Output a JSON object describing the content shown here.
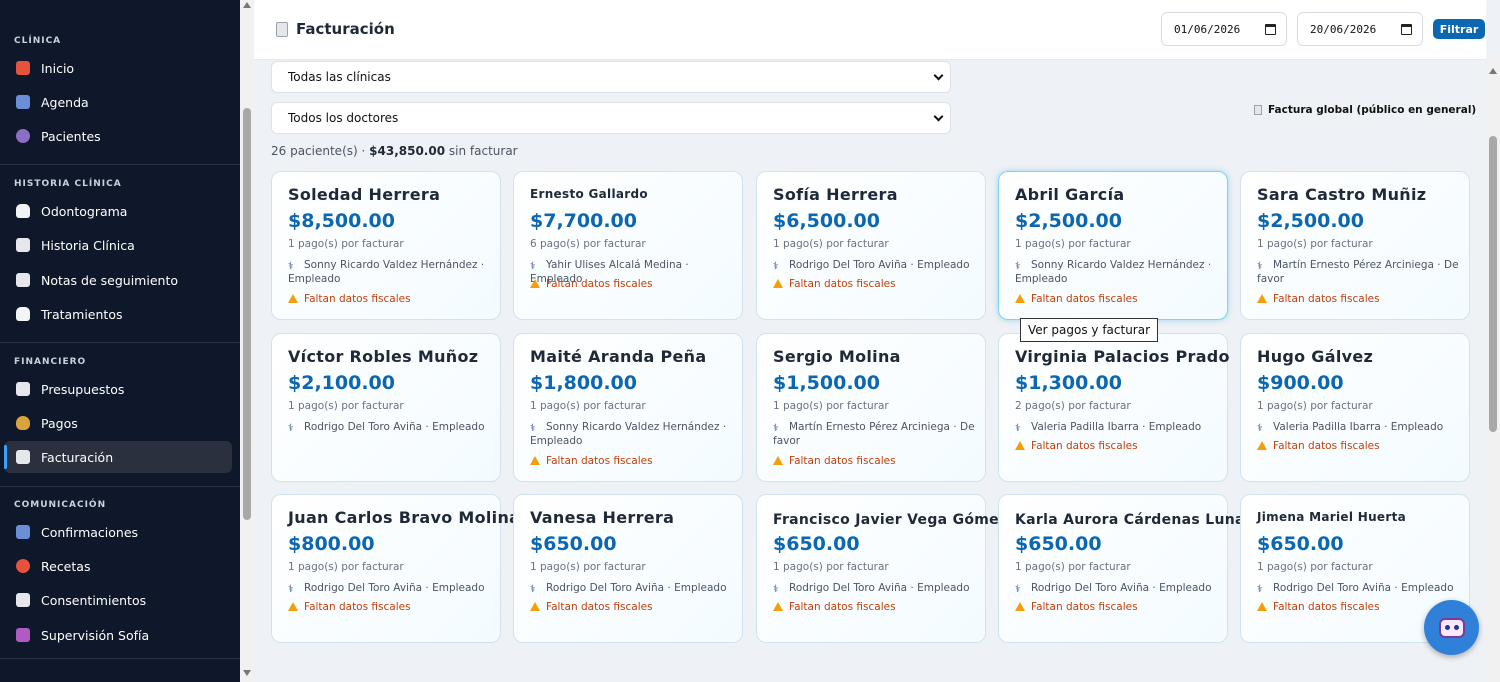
{
  "sidebar": {
    "sections": [
      {
        "title": "CLÍNICA",
        "items": [
          {
            "label": "Inicio",
            "icon": "clinic-icon",
            "color": "#e5533c"
          },
          {
            "label": "Agenda",
            "icon": "calendar-icon",
            "color": "#6b8fd6"
          },
          {
            "label": "Pacientes",
            "icon": "users-icon",
            "color": "#8b6fc4"
          }
        ]
      },
      {
        "title": "HISTORIA CLÍNICA",
        "items": [
          {
            "label": "Odontograma",
            "icon": "tooth-icon",
            "color": "#f3f4f6"
          },
          {
            "label": "Historia Clínica",
            "icon": "clipboard-icon",
            "color": "#e5e7eb"
          },
          {
            "label": "Notas de seguimiento",
            "icon": "notes-icon",
            "color": "#e5e7eb"
          },
          {
            "label": "Tratamientos",
            "icon": "tooth-icon",
            "color": "#f3f4f6"
          }
        ]
      },
      {
        "title": "FINANCIERO",
        "items": [
          {
            "label": "Presupuestos",
            "icon": "document-icon",
            "color": "#e5e7eb"
          },
          {
            "label": "Pagos",
            "icon": "money-bag-icon",
            "color": "#d9a43b"
          },
          {
            "label": "Facturación",
            "icon": "invoice-icon",
            "color": "#e5e7eb"
          }
        ]
      },
      {
        "title": "COMUNICACIÓN",
        "items": [
          {
            "label": "Confirmaciones",
            "icon": "message-icon",
            "color": "#6b8fd6"
          },
          {
            "label": "Recetas",
            "icon": "pill-icon",
            "color": "#e5533c"
          },
          {
            "label": "Consentimientos",
            "icon": "document-icon",
            "color": "#e5e7eb"
          },
          {
            "label": "Supervisión Sofía",
            "icon": "robot-icon",
            "color": "#b05bc4"
          }
        ]
      }
    ]
  },
  "header": {
    "title": "Facturación",
    "date_from": "01/06/2026",
    "date_to": "20/06/2026",
    "filter_label": "Filtrar"
  },
  "filters": {
    "clinic": "Todas las clínicas",
    "doctor": "Todos los doctores",
    "global_invoice": "Factura global (público en general)"
  },
  "summary": {
    "patients": "26 paciente(s) ·",
    "amount": "$43,850.00",
    "suffix": "sin facturar"
  },
  "tooltip": "Ver pagos y facturar",
  "cards": [
    {
      "name": "Soledad Herrera",
      "amount": "$8,500.00",
      "pagos": "1 pago(s) por facturar",
      "doctor": "Sonny Ricardo Valdez Hernández · Empleado",
      "warn": "Faltan datos fiscales"
    },
    {
      "name": "Ernesto Gallardo",
      "amount": "$7,700.00",
      "pagos": "6 pago(s) por facturar",
      "doctor": "Yahir Ulises Alcalá Medina · Empleado",
      "warn": "Faltan datos fiscales"
    },
    {
      "name": "Sofía Herrera",
      "amount": "$6,500.00",
      "pagos": "1 pago(s) por facturar",
      "doctor": "Rodrigo Del Toro Aviña · Empleado",
      "warn": "Faltan datos fiscales"
    },
    {
      "name": "Abril García",
      "amount": "$2,500.00",
      "pagos": "1 pago(s) por facturar",
      "doctor": "Sonny Ricardo Valdez Hernández · Empleado",
      "warn": "Faltan datos fiscales"
    },
    {
      "name": "Sara Castro Muñiz",
      "amount": "$2,500.00",
      "pagos": "1 pago(s) por facturar",
      "doctor": "Martín Ernesto Pérez Arciniega · De favor",
      "warn": "Faltan datos fiscales"
    },
    {
      "name": "Víctor Robles Muñoz",
      "amount": "$2,100.00",
      "pagos": "1 pago(s) por facturar",
      "doctor": "Rodrigo Del Toro Aviña · Empleado",
      "warn": ""
    },
    {
      "name": "Maité Aranda Peña",
      "amount": "$1,800.00",
      "pagos": "1 pago(s) por facturar",
      "doctor": "Sonny Ricardo Valdez Hernández · Empleado",
      "warn": "Faltan datos fiscales"
    },
    {
      "name": "Sergio Molina",
      "amount": "$1,500.00",
      "pagos": "1 pago(s) por facturar",
      "doctor": "Martín Ernesto Pérez Arciniega · De favor",
      "warn": "Faltan datos fiscales"
    },
    {
      "name": "Virginia Palacios Prado",
      "amount": "$1,300.00",
      "pagos": "2 pago(s) por facturar",
      "doctor": "Valeria Padilla Ibarra · Empleado",
      "warn": "Faltan datos fiscales"
    },
    {
      "name": "Hugo Gálvez",
      "amount": "$900.00",
      "pagos": "1 pago(s) por facturar",
      "doctor": "Valeria Padilla Ibarra · Empleado",
      "warn": "Faltan datos fiscales"
    },
    {
      "name": "Juan Carlos Bravo Molina",
      "amount": "$800.00",
      "pagos": "1 pago(s) por facturar",
      "doctor": "Rodrigo Del Toro Aviña · Empleado",
      "warn": "Faltan datos fiscales"
    },
    {
      "name": "Vanesa Herrera",
      "amount": "$650.00",
      "pagos": "1 pago(s) por facturar",
      "doctor": "Rodrigo Del Toro Aviña · Empleado",
      "warn": "Faltan datos fiscales"
    },
    {
      "name": "Francisco Javier Vega Gómez",
      "amount": "$650.00",
      "pagos": "1 pago(s) por facturar",
      "doctor": "Rodrigo Del Toro Aviña · Empleado",
      "warn": "Faltan datos fiscales"
    },
    {
      "name": "Karla Aurora Cárdenas Luna",
      "amount": "$650.00",
      "pagos": "1 pago(s) por facturar",
      "doctor": "Rodrigo Del Toro Aviña · Empleado",
      "warn": "Faltan datos fiscales"
    },
    {
      "name": "Jimena Mariel Huerta",
      "amount": "$650.00",
      "pagos": "1 pago(s) por facturar",
      "doctor": "Rodrigo Del Toro Aviña · Empleado",
      "warn": "Faltan datos fiscales"
    }
  ],
  "colors": {
    "accent": "#0b67b2",
    "sidebar": "#0f172a",
    "warning": "#c2410c"
  }
}
